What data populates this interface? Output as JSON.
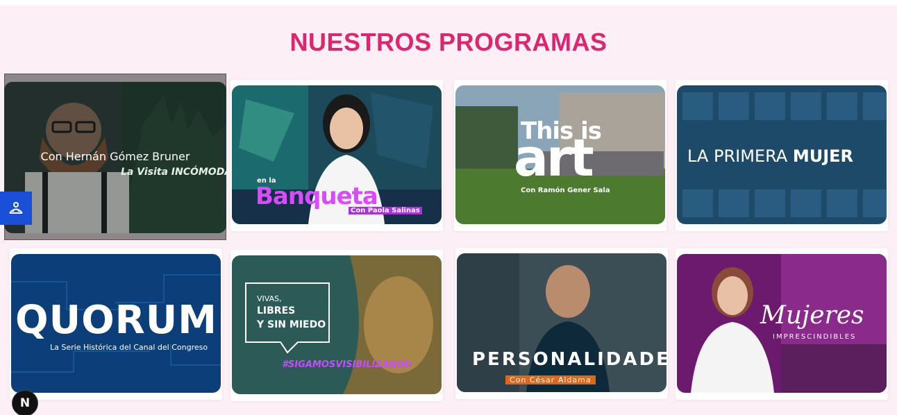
{
  "section": {
    "title": "NUESTROS PROGRAMAS"
  },
  "programs": [
    {
      "id": "la-visita-incomoda",
      "logo_text": "La Visita INCÓMODA",
      "host_text": "Con Hernán Gómez Bruner",
      "overlay_label": "Con Hernán Gómez Bruner"
    },
    {
      "id": "en-la-banqueta",
      "logo_prefix": "en la",
      "logo_text": "Banqueta",
      "host_text": "Con Paola Salinas"
    },
    {
      "id": "this-is-art",
      "logo_line1": "This is",
      "logo_line2": "art",
      "host_text": "Con Ramón Gener Sala"
    },
    {
      "id": "la-primera-mujer",
      "logo_text_light": "LA PRIMERA ",
      "logo_text_bold": "MUJER"
    },
    {
      "id": "quorum",
      "logo_text": "QUORUM",
      "subtitle": "La Serie Histórica del Canal del Congreso"
    },
    {
      "id": "vivas-libres",
      "quote_line1": "VIVAS,",
      "quote_line2": "LIBRES",
      "quote_line3": "Y SIN MIEDO",
      "hashtag": "#SIGAMOSVISIBILIZANDO"
    },
    {
      "id": "personalidades",
      "logo_text": "PERSONALIDADES",
      "host_text": "Con César Aldama"
    },
    {
      "id": "mujeres-imprescindibles",
      "logo_script": "Mujeres",
      "logo_sub": "IMPRESCINDIBLES"
    }
  ],
  "widgets": {
    "accessibility_icon": "accessibility-icon",
    "dev_badge_letter": "N"
  },
  "colors": {
    "accent": "#e0256f",
    "background": "#fcf0f6",
    "accessibility_button": "#1a4fd8"
  }
}
